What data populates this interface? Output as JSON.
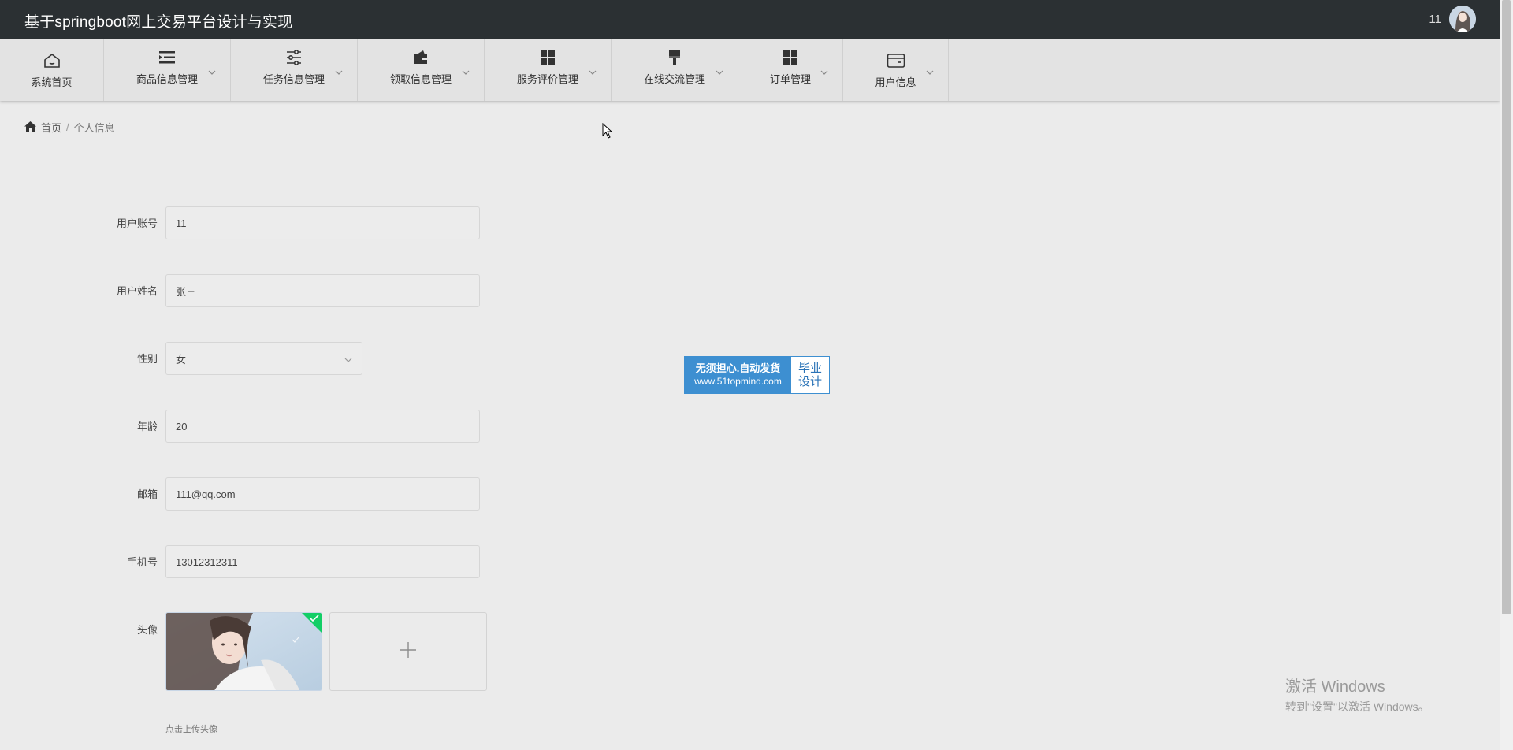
{
  "app": {
    "title": "基于springboot网上交易平台设计与实现",
    "username": "11"
  },
  "nav": {
    "items": [
      {
        "label": "系统首页",
        "icon": "home-icon"
      },
      {
        "label": "商品信息管理",
        "icon": "list-icon"
      },
      {
        "label": "任务信息管理",
        "icon": "sliders-icon"
      },
      {
        "label": "领取信息管理",
        "icon": "wallet-icon"
      },
      {
        "label": "服务评价管理",
        "icon": "grid-icon"
      },
      {
        "label": "在线交流管理",
        "icon": "brush-icon"
      },
      {
        "label": "订单管理",
        "icon": "grid-icon"
      },
      {
        "label": "用户信息",
        "icon": "card-icon"
      }
    ]
  },
  "breadcrumb": {
    "home": "首页",
    "separator": "/",
    "current": "个人信息"
  },
  "form": {
    "account_label": "用户账号",
    "account_value": "11",
    "name_label": "用户姓名",
    "name_value": "张三",
    "gender_label": "性别",
    "gender_value": "女",
    "age_label": "年龄",
    "age_value": "20",
    "email_label": "邮箱",
    "email_value": "111@qq.com",
    "phone_label": "手机号",
    "phone_value": "13012312311",
    "avatar_label": "头像",
    "upload_hint": "点击上传头像"
  },
  "badge": {
    "line1": "无须担心.自动发货",
    "line2": "www.51topmind.com",
    "right1": "毕业",
    "right2": "设计"
  },
  "windows_activation": {
    "title": "激活 Windows",
    "subtitle": "转到\"设置\"以激活 Windows。"
  },
  "colors": {
    "topbar": "#2b3033",
    "navbar": "#e3e3e3",
    "background": "#ebebeb",
    "badge_blue": "#3d8fd1",
    "upload_success": "#13ce66"
  }
}
